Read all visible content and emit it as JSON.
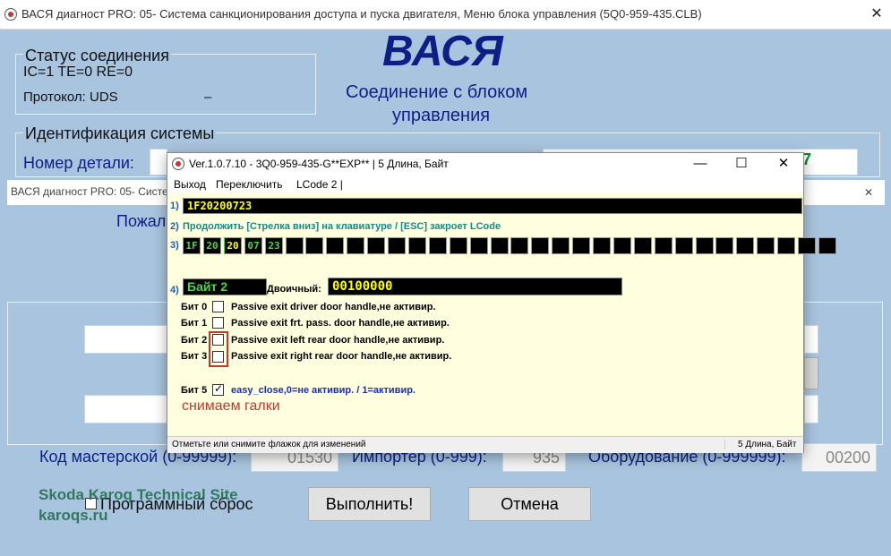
{
  "main": {
    "title": "ВАСЯ диагност PRO: 05- Система санкционирования доступа и пуска двигателя,  Меню блока управления (5Q0-959-435.CLB)",
    "close": "✕",
    "status_group": {
      "title": "Статус соединения",
      "line1": "IC=1  TE=0   RE=0",
      "protocol": "Протокол: UDS",
      "dash": "–"
    },
    "brand": "ВАСЯ",
    "connection_text_1": "Соединение с блоком",
    "connection_text_2": "управления",
    "ident_title": "Идентификация системы",
    "part_label": "Номер детали:",
    "right_field_fragment": "7",
    "partial_label": "Пожал",
    "workshop_label": "Код мастерской (0-99999):",
    "workshop_value": "01530",
    "importer_label": "Импортер (0-999):",
    "importer_value": "935",
    "equipment_label": "Оборудование (0-999999):",
    "equipment_value": "00200",
    "program_reset": "Программный сброс",
    "execute_button": "Выполнить!",
    "cancel_button": "Отмена",
    "watermark_1": "Skoda Karoq Technical Site",
    "watermark_2": "karoqs.ru"
  },
  "second_window": {
    "title": "ВАСЯ диагност PRO: 05- Систем",
    "close": "✕"
  },
  "popup": {
    "title": "Ver.1.0.7.10 -    3Q0-959-435-G**EXP** | 5 Длина, Байт",
    "minimize": "—",
    "maximize": "☐",
    "close": "✕",
    "menu": [
      "Выход",
      "Переключить",
      "LCode 2 |"
    ],
    "row1_label": "1)",
    "row1_value": "1F20200723",
    "row2_label": "2)",
    "row2_text": "Продолжить [Стрелка вниз] на клавиатуре / [ESC] закроет LCode",
    "row3_label": "3)",
    "bytes": [
      "1F",
      "20",
      "20",
      "07",
      "23",
      "",
      "",
      "",
      "",
      "",
      "",
      "",
      "",
      "",
      "",
      "",
      "",
      "",
      "",
      "",
      "",
      "",
      "",
      "",
      "",
      "",
      "",
      "",
      "",
      "",
      "",
      ""
    ],
    "row4_label": "4)",
    "byte_label": "Байт 2",
    "binary_label": "Двоичный:",
    "binary_value": "00100000",
    "bits": [
      {
        "label": "Бит 0",
        "text": "Passive exit driver door handle,не активир.",
        "checked": false
      },
      {
        "label": "Бит 1",
        "text": "Passive exit frt. pass. door handle,не активир.",
        "checked": false
      },
      {
        "label": "Бит 2",
        "text": "Passive exit left rear door handle,не активир.",
        "checked": false
      },
      {
        "label": "Бит 3",
        "text": "Passive exit right rear door handle,не активир.",
        "checked": false
      }
    ],
    "bit5_label": "Бит 5",
    "bit5_text": "easy_close,0=не активир. / 1=активир.",
    "annotation": "снимаем галки",
    "status_left": "Отметьте или снимите флажок для изменений",
    "status_right": "5 Длина, Байт"
  },
  "colors": {
    "background": "#a9c4de",
    "brand_blue": "#0d1f86",
    "popup_body": "#ffffe0",
    "annotation_red": "#c0392b",
    "byte_green": "#4cd44c",
    "byte_yellow": "#ffff00"
  }
}
